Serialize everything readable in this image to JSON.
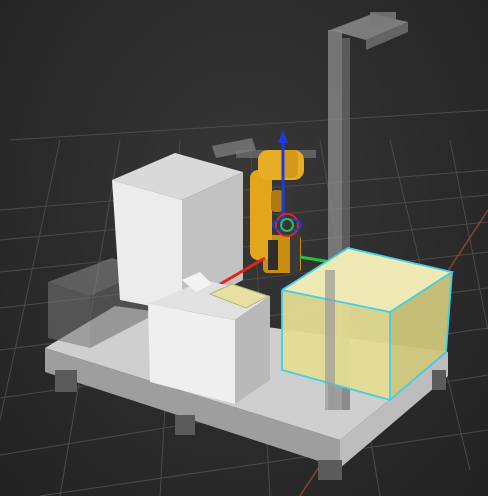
{
  "scene": {
    "background_color": "#2a2a2a",
    "grid_color": "#5a5a5a",
    "x_axis_color": "#b0463f",
    "selection_color": "#3fd0e8",
    "selected_object_fill": "#e9e29a",
    "robot_color": "#e0a21a",
    "gizmo_colors": {
      "x": "#e0261c",
      "y": "#21c73a",
      "z": "#1f3be0"
    },
    "objects": [
      {
        "name": "base-platform"
      },
      {
        "name": "tall-cabinet"
      },
      {
        "name": "glass-enclosure"
      },
      {
        "name": "small-cube-box"
      },
      {
        "name": "yellow-plate"
      },
      {
        "name": "robot-arm"
      },
      {
        "name": "camera-stand"
      },
      {
        "name": "selected-yellow-box"
      }
    ]
  }
}
